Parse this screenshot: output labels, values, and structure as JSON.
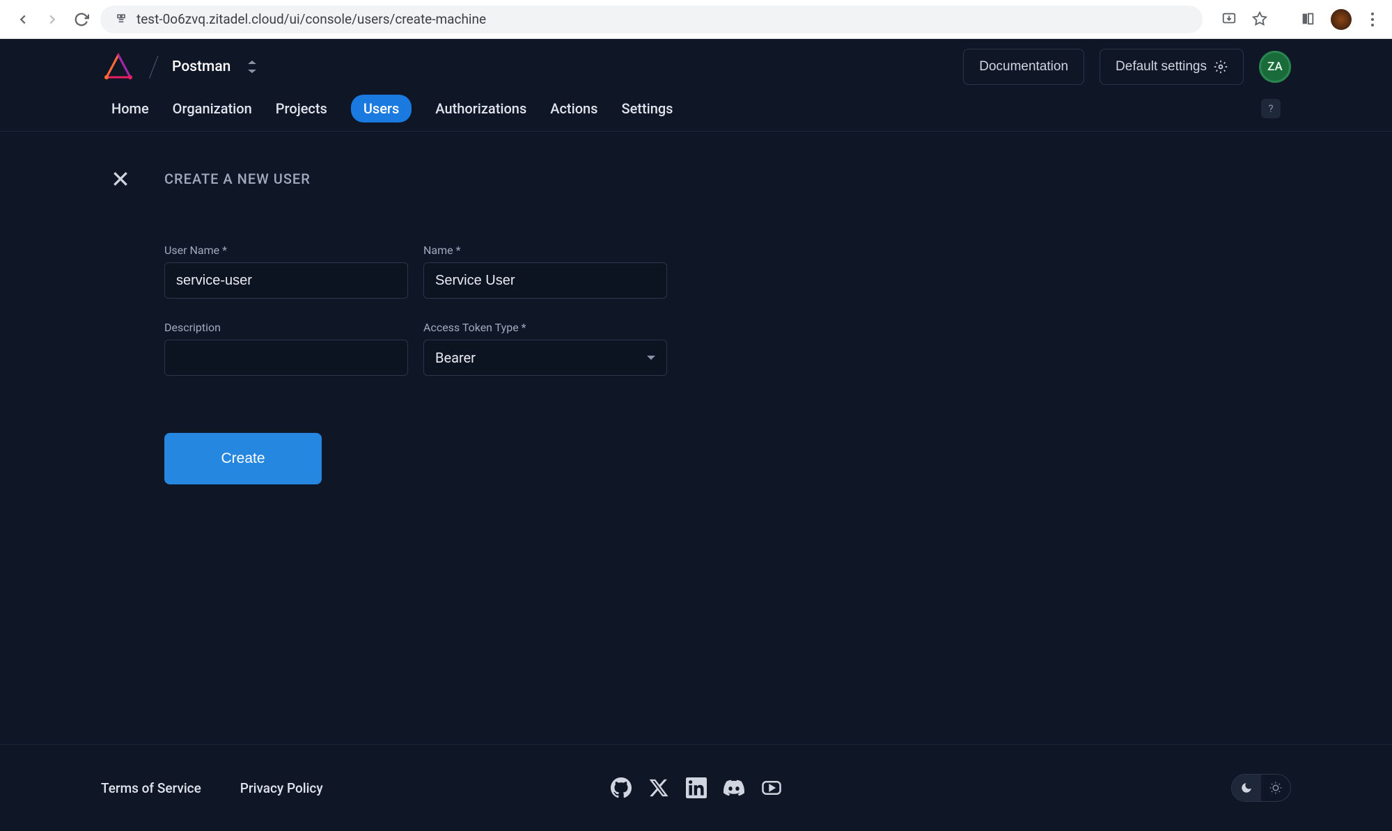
{
  "browser": {
    "url": "test-0o6zvq.zitadel.cloud/ui/console/users/create-machine"
  },
  "header": {
    "org_name": "Postman",
    "documentation_label": "Documentation",
    "default_settings_label": "Default settings",
    "avatar_initials": "ZA"
  },
  "nav": {
    "items": [
      {
        "label": "Home"
      },
      {
        "label": "Organization"
      },
      {
        "label": "Projects"
      },
      {
        "label": "Users"
      },
      {
        "label": "Authorizations"
      },
      {
        "label": "Actions"
      },
      {
        "label": "Settings"
      }
    ],
    "active_index": 3,
    "help_label": "?"
  },
  "page": {
    "title": "CREATE A NEW USER"
  },
  "form": {
    "username_label": "User Name *",
    "username_value": "service-user",
    "name_label": "Name *",
    "name_value": "Service User",
    "description_label": "Description",
    "description_value": "",
    "token_type_label": "Access Token Type *",
    "token_type_value": "Bearer",
    "create_button_label": "Create"
  },
  "footer": {
    "terms_label": "Terms of Service",
    "privacy_label": "Privacy Policy"
  }
}
